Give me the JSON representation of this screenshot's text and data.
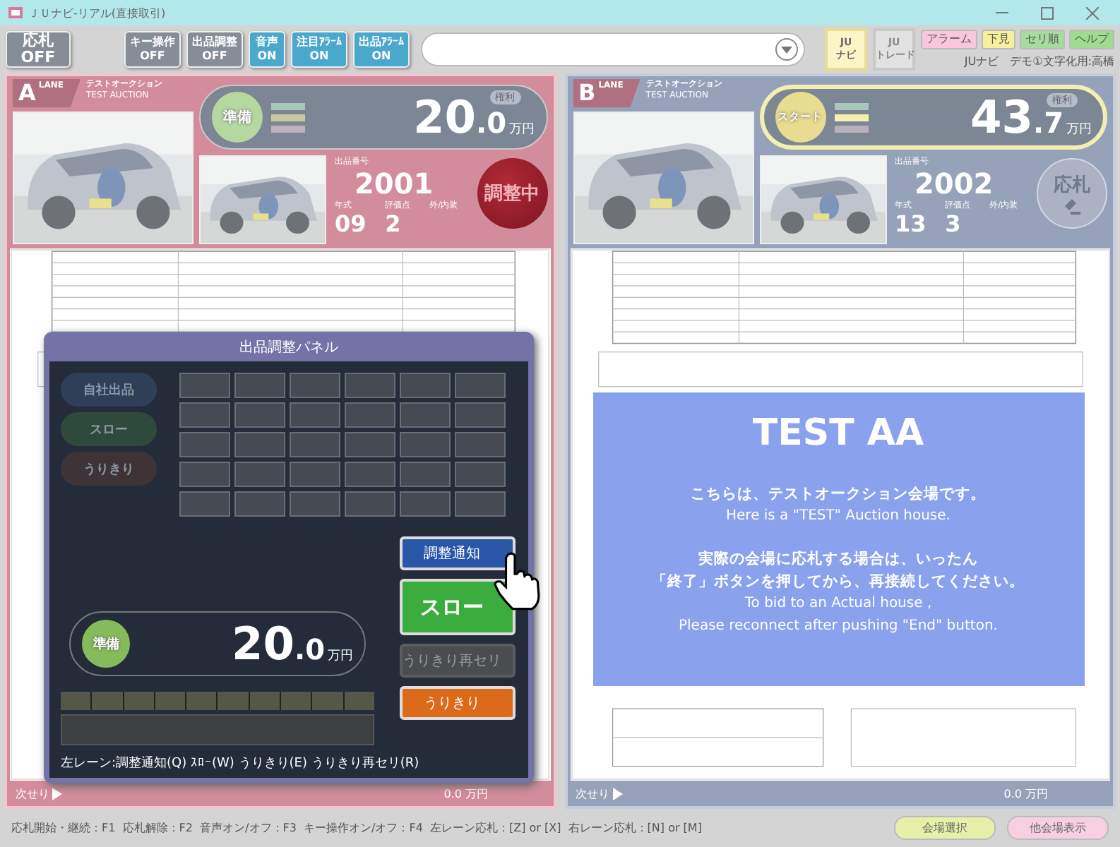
{
  "window": {
    "title": "ＪＵナビ-リアル(直接取引)"
  },
  "toolbar": {
    "bid_toggle": {
      "label": "応札",
      "state": "OFF",
      "on": false
    },
    "toggles": [
      {
        "label": "キー操作",
        "state": "OFF",
        "on": false
      },
      {
        "label": "出品調整",
        "state": "OFF",
        "on": false
      },
      {
        "label": "音声",
        "state": "ON",
        "on": true
      },
      {
        "label": "注目ｱﾗｰﾑ",
        "state": "ON",
        "on": true
      },
      {
        "label": "出品ｱﾗｰﾑ",
        "state": "ON",
        "on": true
      }
    ],
    "mode_buttons": [
      {
        "line1": "JU",
        "line2": "ナビ",
        "selected": true
      },
      {
        "line1": "JU",
        "line2": "トレード",
        "selected": false
      }
    ],
    "menu_buttons": [
      {
        "label": "アラーム",
        "color": "#f9c6dc"
      },
      {
        "label": "下見",
        "color": "#f6ef9c"
      },
      {
        "label": "セリ順",
        "color": "#a6dca0"
      },
      {
        "label": "ヘルプ",
        "color": "#9edc8e"
      }
    ],
    "user": "JUナビ　デモ①文字化用:高橋"
  },
  "lanes": [
    {
      "letter": "A",
      "lane_word": "LANE",
      "house_ja": "テストオークション",
      "house_en": "TEST AUCTION",
      "status": {
        "label": "準備",
        "color": "#b4d8a0"
      },
      "highlighted": false,
      "lamps": [
        {
          "color": "#a8c8bc"
        },
        {
          "color": "#c8c8a0"
        },
        {
          "color": "#c0b0bc"
        }
      ],
      "rights": "権利",
      "price": "20",
      "decimal": ".0",
      "unit": "万円",
      "lot_label": "出品番号",
      "lot": "2001",
      "year_label": "年式",
      "year": "09",
      "score_label": "評価点",
      "score": "2",
      "color_label": "外/内装",
      "action": {
        "label": "調整中",
        "kind": "adjusting"
      },
      "next_label": "次せり",
      "next_price": "0.0 万円"
    },
    {
      "letter": "B",
      "lane_word": "LANE",
      "house_ja": "テストオークション",
      "house_en": "TEST AUCTION",
      "status": {
        "label": "スタート",
        "color": "#e8dc90"
      },
      "highlighted": true,
      "lamps": [
        {
          "color": "#a8c8bc"
        },
        {
          "color": "#f6f0b0"
        },
        {
          "color": "#b8b0bc"
        }
      ],
      "rights": "権利",
      "price": "43",
      "decimal": ".7",
      "unit": "万円",
      "lot_label": "出品番号",
      "lot": "2002",
      "year_label": "年式",
      "year": "13",
      "score_label": "評価点",
      "score": "3",
      "color_label": "外/内装",
      "action": {
        "label": "応札",
        "kind": "bid"
      },
      "next_label": "次せり",
      "next_price": "0.0 万円"
    }
  ],
  "adjust_panel": {
    "title": "出品調整パネル",
    "side_buttons": [
      {
        "label": "自社出品",
        "kind": "own",
        "disabled": true
      },
      {
        "label": "スロー",
        "kind": "slow",
        "disabled": true
      },
      {
        "label": "うりきり",
        "kind": "sell",
        "disabled": true
      }
    ],
    "status": "準備",
    "price": "20",
    "decimal": ".0",
    "unit": "万円",
    "buttons": [
      {
        "label": "調整通知",
        "kind": "notify",
        "disabled": false
      },
      {
        "label": "スロー",
        "kind": "slow",
        "disabled": false
      },
      {
        "label": "うりきり再セリ",
        "kind": "resell",
        "disabled": true
      },
      {
        "label": "うりきり",
        "kind": "sell",
        "disabled": false
      }
    ],
    "shortcuts": "左レーン:調整通知(Q) ｽﾛｰ(W) うりきり(E) うりきり再セリ(R)"
  },
  "notice": {
    "title": "TEST AA",
    "paragraphs": [
      {
        "lines": [
          {
            "text": "こちらは、テストオークション会場です。",
            "kind": "ja"
          },
          {
            "text": "Here is a \"TEST\" Auction house.",
            "kind": "en"
          }
        ]
      },
      {
        "lines": [
          {
            "text": "実際の会場に応札する場合は、いったん",
            "kind": "ja"
          },
          {
            "text": "「終了」ボタンを押してから、再接続してください。",
            "kind": "ja"
          },
          {
            "text": "To bid to an Actual house ,",
            "kind": "en"
          },
          {
            "text": "Please reconnect after pushing \"End\" button.",
            "kind": "en"
          }
        ]
      }
    ]
  },
  "status_bar": {
    "shortcuts": "応札開始・継続：F1  応札解除：F2  音声オン/オフ：F3  キー操作オン/オフ：F4  左レーン応札：[Z] or [X]  右レーン応札：[N] or [M]",
    "buttons": [
      {
        "label": "会場選択",
        "color": "#e6f0a8"
      },
      {
        "label": "他会場表示",
        "color": "#f6d0e0"
      }
    ]
  }
}
